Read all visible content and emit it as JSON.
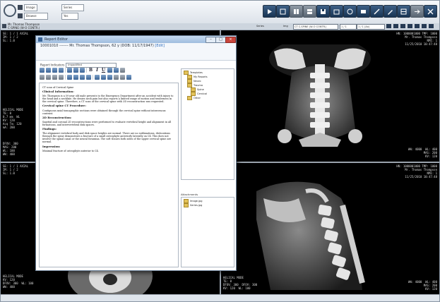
{
  "toolbar": {
    "row1_select": "Image",
    "row1_select2": "Series",
    "row2_select": "Browse",
    "row2_value": "",
    "row3_value": "Yes",
    "title": "",
    "buttons": [
      {
        "icon": "play-icon",
        "style": "dark"
      },
      {
        "icon": "grid-icon",
        "style": "dark"
      },
      {
        "icon": "layout-icon",
        "style": "gray"
      },
      {
        "icon": "layout2-icon",
        "style": "gray"
      },
      {
        "icon": "save-icon",
        "style": "dark"
      },
      {
        "icon": "window-icon",
        "style": "dark"
      },
      {
        "icon": "monitor-icon",
        "style": "dark"
      },
      {
        "icon": "report-icon",
        "style": "dark"
      },
      {
        "icon": "tool-icon",
        "style": "dark"
      },
      {
        "icon": "pen-icon",
        "style": "dark"
      },
      {
        "icon": "layers-icon",
        "style": "dark"
      },
      {
        "icon": "export-icon",
        "style": "gray"
      },
      {
        "icon": "close-icon",
        "style": "dark"
      }
    ]
  },
  "patientbar": {
    "name": "Mr. Thomas Thompson",
    "line2": "C-SPINE (W-O CONTR.)",
    "label1": "Series",
    "label2": "Img",
    "box1": "CT C-SPINE (W-O CONTR.)",
    "box2": "1 / 1",
    "box3": "1 / 1 (Ax)"
  },
  "viewports": {
    "tl": {
      "tl": "SE: 1 / 1 AXIAL\nIM: 1 / 2\nSL: 1.0",
      "ml": "HELICAL MODE\nTE: 0\n0.7 mm  WL\nKV: 120\nAcq Tm: 120\nmA: 200",
      "bl": "DFOV: 300\nMAS: 200\nWL: 100\nWW: 400"
    },
    "tr": {
      "tr": "HN: 1000001000 TMP: 1000\nMr. Thomas Thompson\nNMI: 1\n11/25/2010 10:47:48",
      "ml": "",
      "br": "WW: 4000  WL: 400\nMAS: 200\nKV: 120"
    },
    "bl": {
      "tl": "SE: 1 / 1 AXIAL\nIM: 1 / 2\nSL: 1.0",
      "bl": "HELICAL MODE\nKV: 120\nDFOV: 300  WL: 100\nWW: 400"
    },
    "br": {
      "tr": "HN: 1000001000 TMP: 1000\nMr. Thomas Thompson\nNMI: 1\n11/25/2010 10:47:48",
      "bl": "HELICAL MODE\nTE: 0\nDFOV: 300  DFOV: 300\nKV: 120  WL: 100",
      "br": "WW: 4000  WL: 400\nMAS: 200\nKV: 120"
    }
  },
  "report": {
    "window_title": "Report Editor",
    "header_prefix": "10001010 ------- Mr. Thomas Thompson, 62 y (DOB: 11/17/1947)",
    "header_link": "[Edit]",
    "template_label": "Report Indicators",
    "template_value": "ImpactMed",
    "doc_title": "CT scan of Cervical Spine",
    "sections": [
      {
        "heading": "Clinical Information:",
        "text": "Mr. Thompson is a 59 year old male presents to the Emergency Department after an accident with injury to the head and a neckline. He denies neck pain but also reports a limited range of motion and tenderness in the cervical spine. Therefore, a CT scan of the cervical spine with 3D reconstruction was requested."
      },
      {
        "heading": "Cervical spine CT Procedure:",
        "text": "Contiguous axial tomographic sections were obtained through the cervical spine without intravenous contrast."
      },
      {
        "heading": "2D Reconstruction:",
        "text": "Sagittal and coronal 2D reconstructions were performed to evaluate vertebral height and alignment in all formations, and intervertebral disk spaces."
      },
      {
        "heading": "Findings:",
        "text": "The alignment vertebral body and disk space heights are normal. There are no subluxations, dislocations through the spine demonstrate a fracture of a small osteophyte anteriorly laterally on C4. This does not involve the spinal canal or the neural foramina. The soft tissues both sides of the upper cervical spine are normal."
      },
      {
        "heading": "Impression:",
        "text": "Minimal fracture of osteophyte anterior to C4."
      }
    ],
    "tree": [
      "Templates",
      "My Reports",
      "Neuro",
      "Trauma",
      "Spine",
      "Cervical",
      "Other"
    ],
    "side_label": "Attachments",
    "attachments": [
      "Image.jpg",
      "Series.jpg"
    ]
  }
}
